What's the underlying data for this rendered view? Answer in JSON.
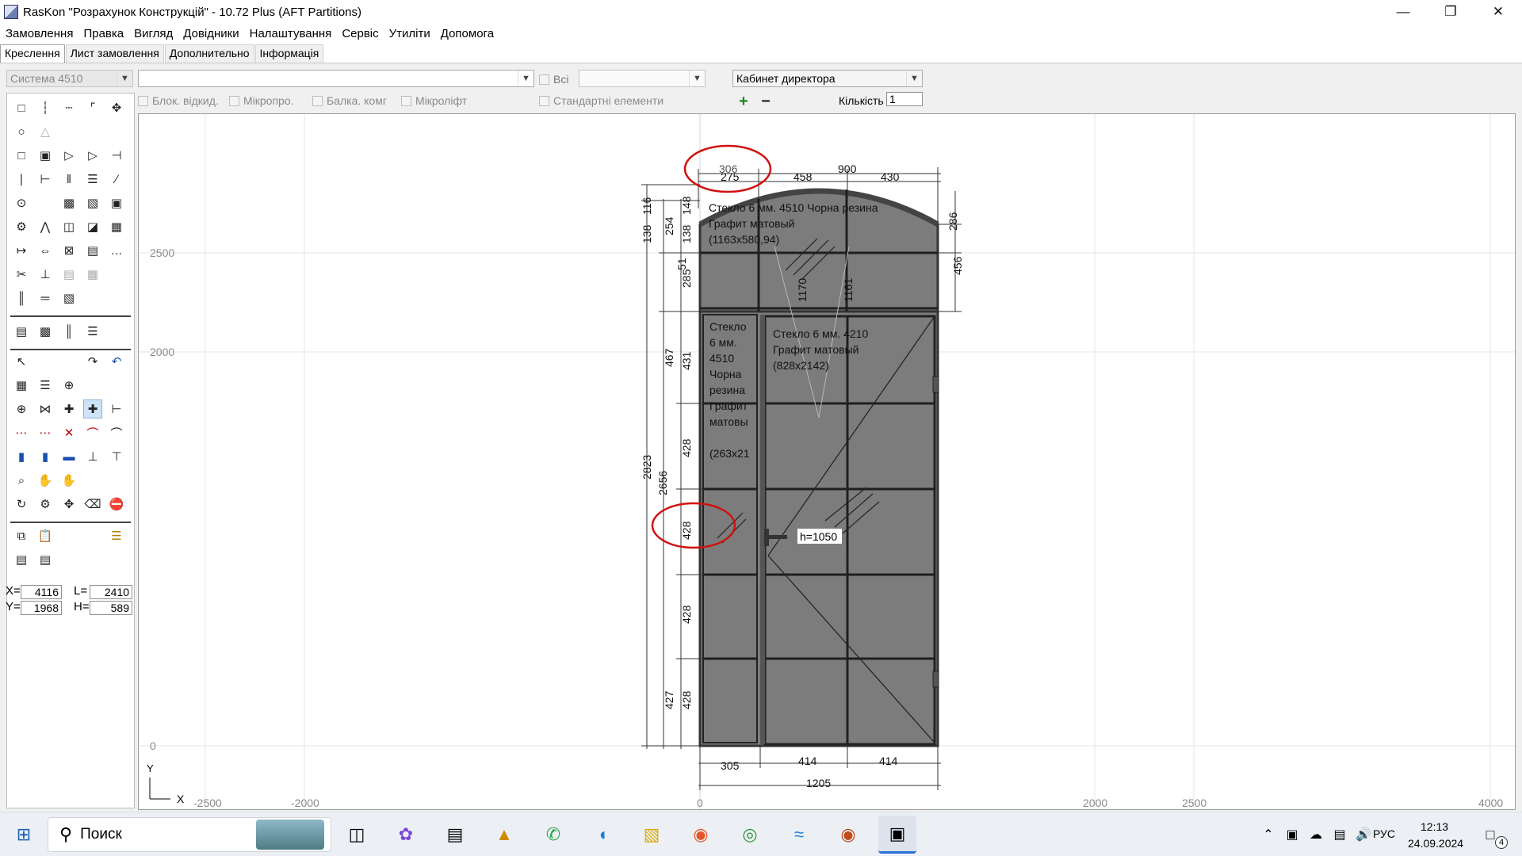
{
  "window": {
    "title": "RasKon \"Розрахунок Конструкцій\" - 10.72 Plus (AFT Partitions)"
  },
  "menu": [
    "Замовлення",
    "Правка",
    "Вигляд",
    "Довідники",
    "Налаштування",
    "Сервіс",
    "Утиліти",
    "Допомога"
  ],
  "tabs": [
    "Креслення",
    "Лист замовлення",
    "Дополнительно",
    "Інформація"
  ],
  "toolbar": {
    "system_combo": "Система 4510",
    "profile_combo": "",
    "all_label": "Всі",
    "filter_combo": "",
    "room_combo": "Кабинет директора",
    "blok_label": "Блок. відкид.",
    "mikropro_label": "Мікропро.",
    "balka_label": "Балка. комг",
    "mikrolift_label": "Мікроліфт",
    "standard_label": "Стандартні елементи",
    "quantity_label": "Кількість",
    "quantity_value": "1"
  },
  "coords": {
    "x_label": "X=",
    "x": "4116",
    "y_label": "Y=",
    "y": "1968",
    "l_label": "L=",
    "l": "2410",
    "h_label": "H=",
    "h": "589"
  },
  "drawing": {
    "axis_x_ticks": [
      "-2500",
      "-2000",
      "0",
      "2000",
      "2500",
      "4000"
    ],
    "axis_y_ticks": [
      "2500",
      "2000",
      "0"
    ],
    "axis_x_label": "X",
    "axis_y_label": "Y",
    "top_dims": [
      "275",
      "458",
      "900",
      "430"
    ],
    "top_overlap": "306",
    "bottom_dims": [
      "305",
      "414",
      "414",
      "1205"
    ],
    "left_outer": [
      "138",
      "116",
      "2823"
    ],
    "left_mid": [
      "254",
      "467",
      "2656",
      "427"
    ],
    "left_inner": [
      "148",
      "138",
      "51",
      "285",
      "431",
      "428",
      "428",
      "428",
      "428"
    ],
    "right_dims": [
      "286",
      "456"
    ],
    "inner_dims": [
      "1170",
      "1161"
    ],
    "glass_top": [
      "Стекло 6 мм. 4510 Чорна резина",
      "Графит матовый",
      "(1163x580,94)"
    ],
    "glass_left": [
      "Стекло",
      "6 мм.",
      "4510",
      "Чорна",
      "резина",
      "Графит",
      "матовы",
      "",
      "(263x21"
    ],
    "glass_right": [
      "Стекло 6 мм. 4210",
      "Графит матовый",
      "(828x2142)"
    ],
    "handle_label": "h=1050"
  },
  "taskbar": {
    "search_placeholder": "Поиск",
    "lang": "РУС",
    "time": "12:13",
    "date": "24.09.2024",
    "notifications": "4"
  }
}
